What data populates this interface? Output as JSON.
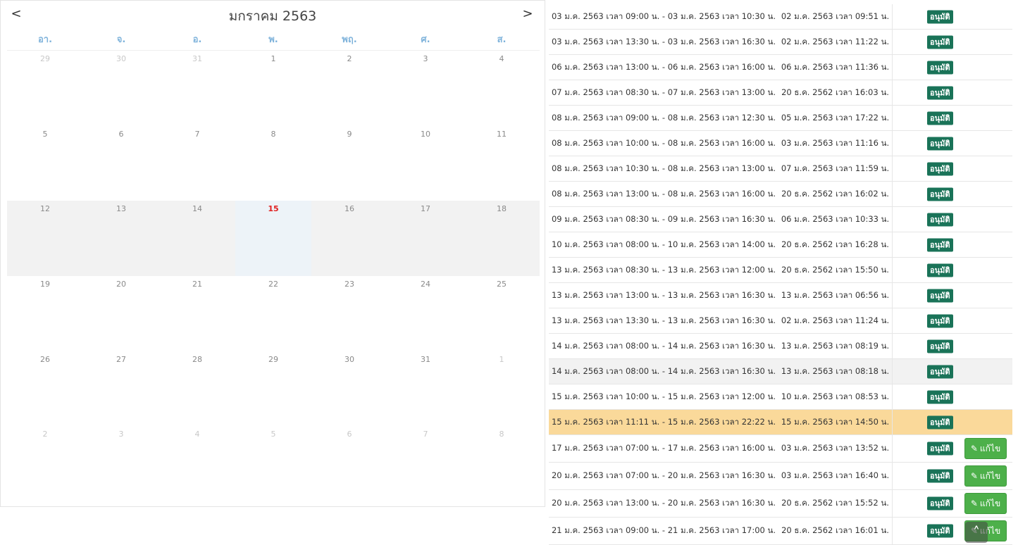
{
  "calendar": {
    "prev_label": "<",
    "next_label": ">",
    "title": "มกราคม 2563",
    "weekdays": [
      "อา.",
      "จ.",
      "อ.",
      "พ.",
      "พฤ.",
      "ศ.",
      "ส."
    ],
    "weeks": [
      [
        "29",
        "30",
        "31",
        "1",
        "2",
        "3",
        "4"
      ],
      [
        "5",
        "6",
        "7",
        "8",
        "9",
        "10",
        "11"
      ],
      [
        "12",
        "13",
        "14",
        "15",
        "16",
        "17",
        "18"
      ],
      [
        "19",
        "20",
        "21",
        "22",
        "23",
        "24",
        "25"
      ],
      [
        "26",
        "27",
        "28",
        "29",
        "30",
        "31",
        "1"
      ],
      [
        "2",
        "3",
        "4",
        "5",
        "6",
        "7",
        "8"
      ]
    ],
    "today": "15",
    "colors": {
      "weekday": "#7fb3db",
      "today": "#e02020",
      "current_week_bg": "#f2f2f2"
    }
  },
  "bookings": {
    "status_color": "#1a7358",
    "edit_color": "#4db04a",
    "highlight_color": "#fad99a",
    "rows": [
      {
        "period": "03 ม.ค. 2563 เวลา 09:00 น. - 03 ม.ค. 2563 เวลา 10:30 น.",
        "created": "02 ม.ค. 2563 เวลา 09:51 น.",
        "status": "อนุมัติ"
      },
      {
        "period": "03 ม.ค. 2563 เวลา 13:30 น. - 03 ม.ค. 2563 เวลา 16:30 น.",
        "created": "02 ม.ค. 2563 เวลา 11:22 น.",
        "status": "อนุมัติ"
      },
      {
        "period": "06 ม.ค. 2563 เวลา 13:00 น. - 06 ม.ค. 2563 เวลา 16:00 น.",
        "created": "06 ม.ค. 2563 เวลา 11:36 น.",
        "status": "อนุมัติ"
      },
      {
        "period": "07 ม.ค. 2563 เวลา 08:30 น. - 07 ม.ค. 2563 เวลา 13:00 น.",
        "created": "20 ธ.ค. 2562 เวลา 16:03 น.",
        "status": "อนุมัติ"
      },
      {
        "period": "08 ม.ค. 2563 เวลา 09:00 น. - 08 ม.ค. 2563 เวลา 12:30 น.",
        "created": "05 ม.ค. 2563 เวลา 17:22 น.",
        "status": "อนุมัติ"
      },
      {
        "period": "08 ม.ค. 2563 เวลา 10:00 น. - 08 ม.ค. 2563 เวลา 16:00 น.",
        "created": "03 ม.ค. 2563 เวลา 11:16 น.",
        "status": "อนุมัติ"
      },
      {
        "period": "08 ม.ค. 2563 เวลา 10:30 น. - 08 ม.ค. 2563 เวลา 13:00 น.",
        "created": "07 ม.ค. 2563 เวลา 11:59 น.",
        "status": "อนุมัติ"
      },
      {
        "period": "08 ม.ค. 2563 เวลา 13:00 น. - 08 ม.ค. 2563 เวลา 16:00 น.",
        "created": "20 ธ.ค. 2562 เวลา 16:02 น.",
        "status": "อนุมัติ"
      },
      {
        "period": "09 ม.ค. 2563 เวลา 08:30 น. - 09 ม.ค. 2563 เวลา 16:30 น.",
        "created": "06 ม.ค. 2563 เวลา 10:33 น.",
        "status": "อนุมัติ"
      },
      {
        "period": "10 ม.ค. 2563 เวลา 08:00 น. - 10 ม.ค. 2563 เวลา 14:00 น.",
        "created": "20 ธ.ค. 2562 เวลา 16:28 น.",
        "status": "อนุมัติ"
      },
      {
        "period": "13 ม.ค. 2563 เวลา 08:30 น. - 13 ม.ค. 2563 เวลา 12:00 น.",
        "created": "20 ธ.ค. 2562 เวลา 15:50 น.",
        "status": "อนุมัติ"
      },
      {
        "period": "13 ม.ค. 2563 เวลา 13:00 น. - 13 ม.ค. 2563 เวลา 16:30 น.",
        "created": "13 ม.ค. 2563 เวลา 06:56 น.",
        "status": "อนุมัติ"
      },
      {
        "period": "13 ม.ค. 2563 เวลา 13:30 น. - 13 ม.ค. 2563 เวลา 16:30 น.",
        "created": "02 ม.ค. 2563 เวลา 11:24 น.",
        "status": "อนุมัติ"
      },
      {
        "period": "14 ม.ค. 2563 เวลา 08:00 น. - 14 ม.ค. 2563 เวลา 16:30 น.",
        "created": "13 ม.ค. 2563 เวลา 08:19 น.",
        "status": "อนุมัติ"
      },
      {
        "period": "14 ม.ค. 2563 เวลา 08:00 น. - 14 ม.ค. 2563 เวลา 16:30 น.",
        "created": "13 ม.ค. 2563 เวลา 08:18 น.",
        "status": "อนุมัติ",
        "style": "alt"
      },
      {
        "period": "15 ม.ค. 2563 เวลา 10:00 น. - 15 ม.ค. 2563 เวลา 12:00 น.",
        "created": "10 ม.ค. 2563 เวลา 08:53 น.",
        "status": "อนุมัติ"
      },
      {
        "period": "15 ม.ค. 2563 เวลา 11:11 น. - 15 ม.ค. 2563 เวลา 22:22 น.",
        "created": "15 ม.ค. 2563 เวลา 14:50 น.",
        "status": "อนุมัติ",
        "style": "hl"
      },
      {
        "period": "17 ม.ค. 2563 เวลา 07:00 น. - 17 ม.ค. 2563 เวลา 16:00 น.",
        "created": "03 ม.ค. 2563 เวลา 13:52 น.",
        "status": "อนุมัติ",
        "edit": "แก้ไข"
      },
      {
        "period": "20 ม.ค. 2563 เวลา 07:00 น. - 20 ม.ค. 2563 เวลา 16:30 น.",
        "created": "03 ม.ค. 2563 เวลา 16:40 น.",
        "status": "อนุมัติ",
        "edit": "แก้ไข"
      },
      {
        "period": "20 ม.ค. 2563 เวลา 13:00 น. - 20 ม.ค. 2563 เวลา 16:30 น.",
        "created": "20 ธ.ค. 2562 เวลา 15:52 น.",
        "status": "อนุมัติ",
        "edit": "แก้ไข"
      },
      {
        "period": "21 ม.ค. 2563 เวลา 09:00 น. - 21 ม.ค. 2563 เวลา 17:00 น.",
        "created": "20 ธ.ค. 2562 เวลา 16:01 น.",
        "status": "อนุมัติ",
        "edit": "แก้ไข"
      }
    ]
  },
  "icons": {
    "pencil": "pencil-icon",
    "scroll_top": "chevron-up-icon"
  }
}
